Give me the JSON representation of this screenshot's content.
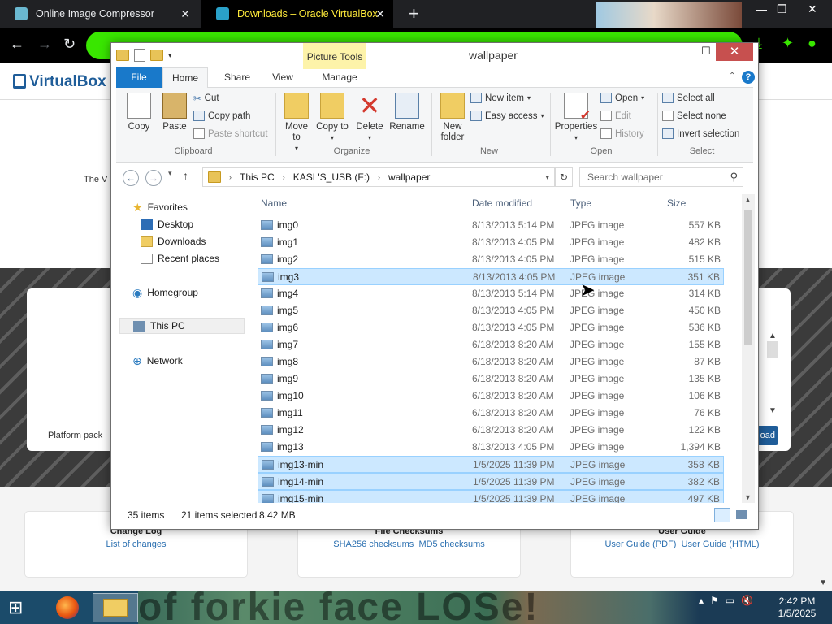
{
  "browser": {
    "tabs": [
      {
        "title": "Online Image Compressor",
        "close": "✕"
      },
      {
        "title": "Downloads – Oracle VirtualBox",
        "close": "✕"
      }
    ],
    "new_tab": "+",
    "back": "←",
    "forward": "→",
    "reload": "↻",
    "window_controls": {
      "min": "—",
      "max": "❐",
      "close": "✕"
    }
  },
  "page": {
    "logo": "VirtualBox",
    "intro_fragment": "The V",
    "platform_fragment": "Platform pack",
    "download_fragment": "oad",
    "cards": [
      {
        "title": "Change Log",
        "links": [
          "List of changes"
        ]
      },
      {
        "title": "File Checksums",
        "links": [
          "SHA256 checksums",
          "MD5 checksums"
        ]
      },
      {
        "title": "User Guide",
        "links": [
          "User Guide (PDF)",
          "User Guide (HTML)"
        ]
      }
    ]
  },
  "explorer": {
    "title": "wallpaper",
    "context_tab": "Picture Tools",
    "window_controls": {
      "min": "—",
      "max": "☐",
      "close": "✕"
    },
    "ribbon_tabs": [
      "File",
      "Home",
      "Share",
      "View",
      "Manage"
    ],
    "ribbon": {
      "clipboard": {
        "label": "Clipboard",
        "copy": "Copy",
        "paste": "Paste",
        "cut": "Cut",
        "copy_path": "Copy path",
        "paste_shortcut": "Paste shortcut"
      },
      "organize": {
        "label": "Organize",
        "move_to": "Move to",
        "copy_to": "Copy to",
        "delete": "Delete",
        "rename": "Rename"
      },
      "new": {
        "label": "New",
        "new_folder": "New folder",
        "new_item": "New item",
        "easy_access": "Easy access"
      },
      "open": {
        "label": "Open",
        "properties": "Properties",
        "open": "Open",
        "edit": "Edit",
        "history": "History"
      },
      "select": {
        "label": "Select",
        "select_all": "Select all",
        "select_none": "Select none",
        "invert": "Invert selection"
      }
    },
    "address": {
      "path": [
        "This PC",
        "KASL'S_USB (F:)",
        "wallpaper"
      ]
    },
    "search_placeholder": "Search wallpaper",
    "nav_pane": {
      "favorites": "Favorites",
      "favorites_items": [
        "Desktop",
        "Downloads",
        "Recent places"
      ],
      "homegroup": "Homegroup",
      "this_pc": "This PC",
      "network": "Network"
    },
    "columns": {
      "name": "Name",
      "date": "Date modified",
      "type": "Type",
      "size": "Size"
    },
    "files": [
      {
        "name": "img0",
        "date": "8/13/2013 5:14 PM",
        "type": "JPEG image",
        "size": "557 KB",
        "selected": false
      },
      {
        "name": "img1",
        "date": "8/13/2013 4:05 PM",
        "type": "JPEG image",
        "size": "482 KB",
        "selected": false
      },
      {
        "name": "img2",
        "date": "8/13/2013 4:05 PM",
        "type": "JPEG image",
        "size": "515 KB",
        "selected": false
      },
      {
        "name": "img3",
        "date": "8/13/2013 4:05 PM",
        "type": "JPEG image",
        "size": "351 KB",
        "selected": true
      },
      {
        "name": "img4",
        "date": "8/13/2013 5:14 PM",
        "type": "JPEG image",
        "size": "314 KB",
        "selected": false
      },
      {
        "name": "img5",
        "date": "8/13/2013 4:05 PM",
        "type": "JPEG image",
        "size": "450 KB",
        "selected": false
      },
      {
        "name": "img6",
        "date": "8/13/2013 4:05 PM",
        "type": "JPEG image",
        "size": "536 KB",
        "selected": false
      },
      {
        "name": "img7",
        "date": "6/18/2013 8:20 AM",
        "type": "JPEG image",
        "size": "155 KB",
        "selected": false
      },
      {
        "name": "img8",
        "date": "6/18/2013 8:20 AM",
        "type": "JPEG image",
        "size": "87 KB",
        "selected": false
      },
      {
        "name": "img9",
        "date": "6/18/2013 8:20 AM",
        "type": "JPEG image",
        "size": "135 KB",
        "selected": false
      },
      {
        "name": "img10",
        "date": "6/18/2013 8:20 AM",
        "type": "JPEG image",
        "size": "106 KB",
        "selected": false
      },
      {
        "name": "img11",
        "date": "6/18/2013 8:20 AM",
        "type": "JPEG image",
        "size": "76 KB",
        "selected": false
      },
      {
        "name": "img12",
        "date": "6/18/2013 8:20 AM",
        "type": "JPEG image",
        "size": "122 KB",
        "selected": false
      },
      {
        "name": "img13",
        "date": "8/13/2013 4:05 PM",
        "type": "JPEG image",
        "size": "1,394 KB",
        "selected": false
      },
      {
        "name": "img13-min",
        "date": "1/5/2025 11:39 PM",
        "type": "JPEG image",
        "size": "358 KB",
        "selected": true
      },
      {
        "name": "img14-min",
        "date": "1/5/2025 11:39 PM",
        "type": "JPEG image",
        "size": "382 KB",
        "selected": true
      },
      {
        "name": "img15-min",
        "date": "1/5/2025 11:39 PM",
        "type": "JPEG image",
        "size": "497 KB",
        "selected": true
      }
    ],
    "status": {
      "items": "35 items",
      "selected": "21 items selected",
      "size": "8.42 MB"
    }
  },
  "taskbar": {
    "clock_time": "2:42 PM",
    "clock_date": "1/5/2025",
    "wallpaper_text": "of forkie face      LOSe!"
  }
}
